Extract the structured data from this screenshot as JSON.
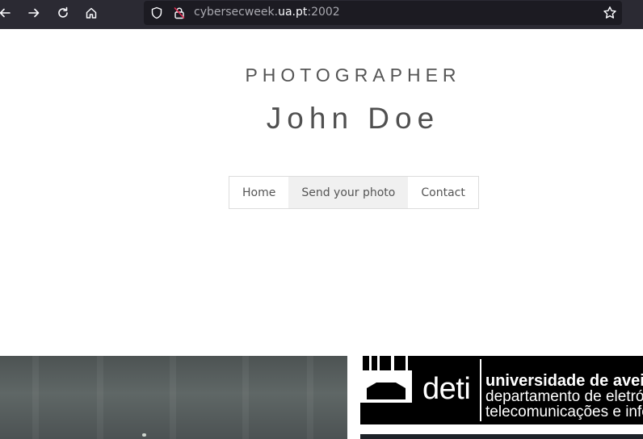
{
  "browser": {
    "url_prefix": "cybersecweek.",
    "url_host": "ua.pt",
    "url_suffix": ":2002",
    "icons": [
      "back-icon",
      "forward-icon",
      "reload-icon",
      "home-icon",
      "shield-icon",
      "insecure-lock-icon",
      "bookmark-star-icon"
    ]
  },
  "header": {
    "subtitle": "PHOTOGRAPHER",
    "title": "John Doe"
  },
  "menu": {
    "items": [
      {
        "label": "Home"
      },
      {
        "label": "Send your photo",
        "active": true
      },
      {
        "label": "Contact"
      }
    ]
  },
  "banner": {
    "brand": "deti",
    "line1": "universidade de aveiro",
    "line2": "departamento de eletrónica",
    "line3": "telecomunicações e informática"
  },
  "colors": {
    "chrome_bg": "#2b2a33",
    "urlbar_bg": "#1c1b22",
    "text": "#555555",
    "active_menu_bg": "#f0f0f0"
  }
}
